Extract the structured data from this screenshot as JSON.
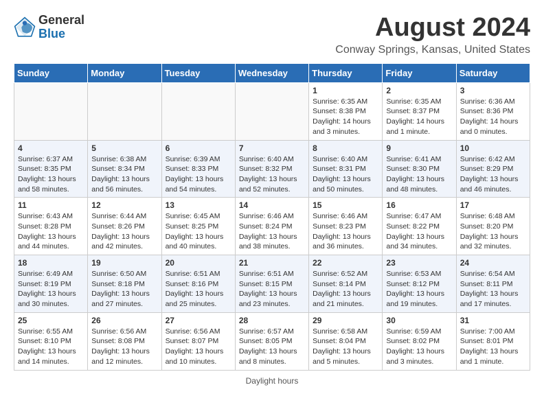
{
  "logo": {
    "general": "General",
    "blue": "Blue"
  },
  "title": "August 2024",
  "subtitle": "Conway Springs, Kansas, United States",
  "days_of_week": [
    "Sunday",
    "Monday",
    "Tuesday",
    "Wednesday",
    "Thursday",
    "Friday",
    "Saturday"
  ],
  "footer": "Daylight hours",
  "weeks": [
    [
      {
        "day": "",
        "info": ""
      },
      {
        "day": "",
        "info": ""
      },
      {
        "day": "",
        "info": ""
      },
      {
        "day": "",
        "info": ""
      },
      {
        "day": "1",
        "info": "Sunrise: 6:35 AM\nSunset: 8:38 PM\nDaylight: 14 hours and 3 minutes."
      },
      {
        "day": "2",
        "info": "Sunrise: 6:35 AM\nSunset: 8:37 PM\nDaylight: 14 hours and 1 minute."
      },
      {
        "day": "3",
        "info": "Sunrise: 6:36 AM\nSunset: 8:36 PM\nDaylight: 14 hours and 0 minutes."
      }
    ],
    [
      {
        "day": "4",
        "info": "Sunrise: 6:37 AM\nSunset: 8:35 PM\nDaylight: 13 hours and 58 minutes."
      },
      {
        "day": "5",
        "info": "Sunrise: 6:38 AM\nSunset: 8:34 PM\nDaylight: 13 hours and 56 minutes."
      },
      {
        "day": "6",
        "info": "Sunrise: 6:39 AM\nSunset: 8:33 PM\nDaylight: 13 hours and 54 minutes."
      },
      {
        "day": "7",
        "info": "Sunrise: 6:40 AM\nSunset: 8:32 PM\nDaylight: 13 hours and 52 minutes."
      },
      {
        "day": "8",
        "info": "Sunrise: 6:40 AM\nSunset: 8:31 PM\nDaylight: 13 hours and 50 minutes."
      },
      {
        "day": "9",
        "info": "Sunrise: 6:41 AM\nSunset: 8:30 PM\nDaylight: 13 hours and 48 minutes."
      },
      {
        "day": "10",
        "info": "Sunrise: 6:42 AM\nSunset: 8:29 PM\nDaylight: 13 hours and 46 minutes."
      }
    ],
    [
      {
        "day": "11",
        "info": "Sunrise: 6:43 AM\nSunset: 8:28 PM\nDaylight: 13 hours and 44 minutes."
      },
      {
        "day": "12",
        "info": "Sunrise: 6:44 AM\nSunset: 8:26 PM\nDaylight: 13 hours and 42 minutes."
      },
      {
        "day": "13",
        "info": "Sunrise: 6:45 AM\nSunset: 8:25 PM\nDaylight: 13 hours and 40 minutes."
      },
      {
        "day": "14",
        "info": "Sunrise: 6:46 AM\nSunset: 8:24 PM\nDaylight: 13 hours and 38 minutes."
      },
      {
        "day": "15",
        "info": "Sunrise: 6:46 AM\nSunset: 8:23 PM\nDaylight: 13 hours and 36 minutes."
      },
      {
        "day": "16",
        "info": "Sunrise: 6:47 AM\nSunset: 8:22 PM\nDaylight: 13 hours and 34 minutes."
      },
      {
        "day": "17",
        "info": "Sunrise: 6:48 AM\nSunset: 8:20 PM\nDaylight: 13 hours and 32 minutes."
      }
    ],
    [
      {
        "day": "18",
        "info": "Sunrise: 6:49 AM\nSunset: 8:19 PM\nDaylight: 13 hours and 30 minutes."
      },
      {
        "day": "19",
        "info": "Sunrise: 6:50 AM\nSunset: 8:18 PM\nDaylight: 13 hours and 27 minutes."
      },
      {
        "day": "20",
        "info": "Sunrise: 6:51 AM\nSunset: 8:16 PM\nDaylight: 13 hours and 25 minutes."
      },
      {
        "day": "21",
        "info": "Sunrise: 6:51 AM\nSunset: 8:15 PM\nDaylight: 13 hours and 23 minutes."
      },
      {
        "day": "22",
        "info": "Sunrise: 6:52 AM\nSunset: 8:14 PM\nDaylight: 13 hours and 21 minutes."
      },
      {
        "day": "23",
        "info": "Sunrise: 6:53 AM\nSunset: 8:12 PM\nDaylight: 13 hours and 19 minutes."
      },
      {
        "day": "24",
        "info": "Sunrise: 6:54 AM\nSunset: 8:11 PM\nDaylight: 13 hours and 17 minutes."
      }
    ],
    [
      {
        "day": "25",
        "info": "Sunrise: 6:55 AM\nSunset: 8:10 PM\nDaylight: 13 hours and 14 minutes."
      },
      {
        "day": "26",
        "info": "Sunrise: 6:56 AM\nSunset: 8:08 PM\nDaylight: 13 hours and 12 minutes."
      },
      {
        "day": "27",
        "info": "Sunrise: 6:56 AM\nSunset: 8:07 PM\nDaylight: 13 hours and 10 minutes."
      },
      {
        "day": "28",
        "info": "Sunrise: 6:57 AM\nSunset: 8:05 PM\nDaylight: 13 hours and 8 minutes."
      },
      {
        "day": "29",
        "info": "Sunrise: 6:58 AM\nSunset: 8:04 PM\nDaylight: 13 hours and 5 minutes."
      },
      {
        "day": "30",
        "info": "Sunrise: 6:59 AM\nSunset: 8:02 PM\nDaylight: 13 hours and 3 minutes."
      },
      {
        "day": "31",
        "info": "Sunrise: 7:00 AM\nSunset: 8:01 PM\nDaylight: 13 hours and 1 minute."
      }
    ]
  ]
}
